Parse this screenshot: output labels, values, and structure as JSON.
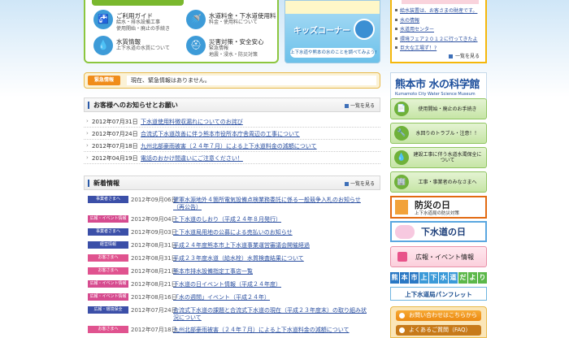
{
  "services": [
    {
      "title": "ご利用ガイド",
      "sub": [
        "給水・排水設備工事",
        "使用開始・廃止の手続き"
      ],
      "icon": "faucet-icon",
      "glyph": "🚰"
    },
    {
      "title": "水道料金・下水道使用料",
      "sub": [
        "料金・使用料について"
      ],
      "icon": "tap-icon",
      "glyph": "🚿"
    },
    {
      "title": "水質情報",
      "sub": [
        "上下水道の水質について"
      ],
      "icon": "water-drop-icon",
      "glyph": "💧"
    },
    {
      "title": "災害対策・安全安心",
      "sub": [
        "緊急情報",
        "地震・浸水・防災対策"
      ],
      "icon": "helmet-icon",
      "glyph": "⛑"
    }
  ],
  "kids": {
    "title": "キッズコーナー",
    "caption": "上下水道や熊本の水のことを調べてみよう!"
  },
  "side_top": {
    "links": [
      "給水装置は、お客さまの財産です。",
      "水の情報",
      "水道用センター",
      "環境フェア２０１２に行ってきたよ",
      "巨大な工場ず！?"
    ],
    "more": "一覧を見る"
  },
  "emergency": {
    "badge": "緊急情報",
    "text": "現在、緊急情報はありません。"
  },
  "notices": {
    "title": "お客様へのお知らせとお願い",
    "more": "一覧を見る",
    "items": [
      {
        "date": "2012年07月31日",
        "text": "下水道使用料徴収漏れについてのお詫び"
      },
      {
        "date": "2012年07月24日",
        "text": "合流式下水道改善に伴う熊本市役所本庁舎周辺の工事について"
      },
      {
        "date": "2012年07月18日",
        "text": "九州北部豪雨被害（２４年７月）による上下水道料金の減額について"
      },
      {
        "date": "2012年04月19日",
        "text": "電話のおかけ間違いにご注意ください！"
      }
    ]
  },
  "news": {
    "title": "新着情報",
    "more": "一覧を見る",
    "items": [
      {
        "tag": "事業者さまへ",
        "tagColor": "#3b4fa8",
        "date": "2012年09月06日",
        "text": [
          "健軍水源地外４箇所電気設備点検業務委託に係る一般競争入札のお知らせ",
          "（再公告）"
        ]
      },
      {
        "tag": "広報・イベント情報",
        "tagColor": "#d64b8f",
        "date": "2012年09月04日",
        "text": [
          "上下水道のしおり（平成２４年８月発行）"
        ]
      },
      {
        "tag": "事業者さまへ",
        "tagColor": "#3b4fa8",
        "date": "2012年09月03日",
        "text": [
          "上下水道局用地の公募による売払いのお知らせ"
        ]
      },
      {
        "tag": "経営情報",
        "tagColor": "#3b4fa8",
        "date": "2012年08月31日",
        "text": [
          "平成２４年度熊本市上下水道事業運営審議会開催経過"
        ]
      },
      {
        "tag": "お客さまへ",
        "tagColor": "#e0538f",
        "date": "2012年08月31日",
        "text": [
          "平成２３年度水道（給水栓）水質検査結果について"
        ]
      },
      {
        "tag": "お客さまへ",
        "tagColor": "#e0538f",
        "date": "2012年08月21日",
        "text": [
          "熊本市排水設備指定工事店一覧"
        ]
      },
      {
        "tag": "広報・イベント情報",
        "tagColor": "#d64b8f",
        "date": "2012年08月21日",
        "text": [
          "下水道の日イベント情報（平成２４年度）"
        ]
      },
      {
        "tag": "広報・イベント情報",
        "tagColor": "#d64b8f",
        "date": "2012年08月16日",
        "text": [
          "「水の週間」イベント（平成２４年）"
        ]
      },
      {
        "tag": "広報・環境保全",
        "tagColor": "#3b4fa8",
        "date": "2012年07月24日",
        "text": [
          "合流式下水道の課題と合流式下水道の現在（平成２３年度末）の取り組み状",
          "況について"
        ]
      },
      {
        "tag": "お客さまへ",
        "tagColor": "#e0538f",
        "date": "2012年07月18日",
        "text": [
          "九州北部豪雨被害（２４年７月）による上下水道料金の減額について"
        ]
      }
    ]
  },
  "museum": {
    "title": "熊本市 水の科学館",
    "sub": "Kumamoto City Water Science Museum"
  },
  "side_buttons": [
    {
      "label": "使用開始・廃止のお手続き",
      "icon": "document-icon",
      "glyph": "📄"
    },
    {
      "label": "水回りのトラブル・注意！！",
      "icon": "wrench-icon",
      "glyph": "🔧"
    },
    {
      "label": "建設工事に伴う水道水濁保全について",
      "icon": "drop-icon",
      "glyph": "💧"
    },
    {
      "label": "工事・事業者のみなさまへ",
      "icon": "building-icon",
      "glyph": "🏢"
    }
  ],
  "banners": {
    "bousai": {
      "title": "防災の日",
      "sub": "上下水道局の防災対策"
    },
    "gesui": {
      "title": "下水道の日"
    },
    "event": {
      "title": "広報・イベント情報"
    },
    "dayori": {
      "chars": [
        "熊",
        "本",
        "市",
        "上",
        "下",
        "水",
        "道",
        "だ",
        "よ",
        "り"
      ]
    },
    "pamph": {
      "title": "上下水道局パンフレット"
    },
    "contact": {
      "title": "お問い合わせはこちらから"
    },
    "faq": {
      "title": "よくあるご質問（FAQ）"
    }
  }
}
